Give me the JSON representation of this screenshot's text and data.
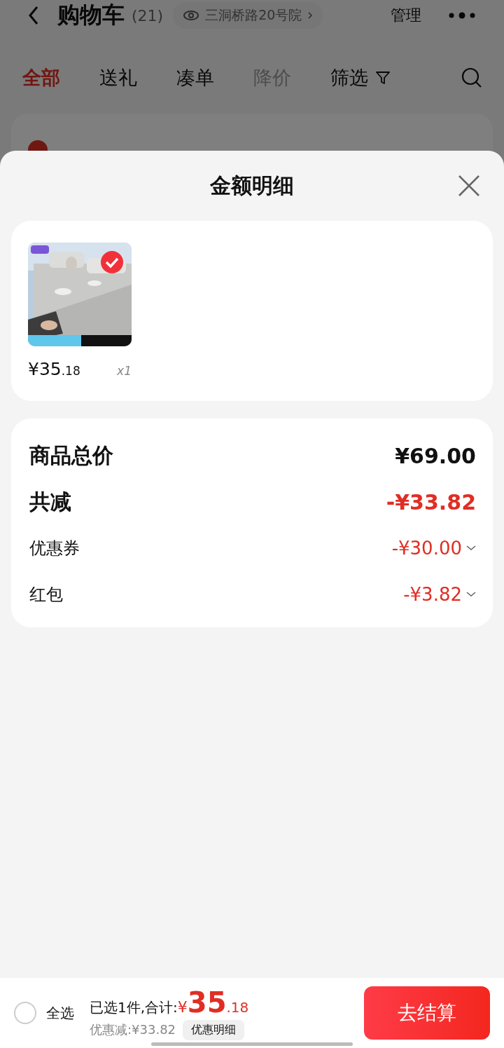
{
  "header": {
    "title": "购物车",
    "count": "(21)",
    "address": "三洞桥路20号院",
    "manage": "管理"
  },
  "tabs": [
    {
      "label": "全部",
      "selected": true,
      "disabled": false,
      "kind": "plain"
    },
    {
      "label": "送礼",
      "selected": false,
      "disabled": false,
      "kind": "plain"
    },
    {
      "label": "凑单",
      "selected": false,
      "disabled": false,
      "kind": "plain"
    },
    {
      "label": "降价",
      "selected": false,
      "disabled": true,
      "kind": "plain"
    },
    {
      "label": "筛选",
      "selected": false,
      "disabled": false,
      "kind": "filter"
    }
  ],
  "sheet": {
    "title": "金额明细",
    "items": [
      {
        "kind": "picture",
        "checked": true,
        "price_main": "¥35",
        "price_decimal": ".18",
        "quantity": "x1"
      }
    ],
    "summary": [
      {
        "kind": "total",
        "label": "商品总价",
        "value": "¥69.00"
      },
      {
        "kind": "discount",
        "label": "共减",
        "value": "-¥33.82"
      },
      {
        "kind": "detail",
        "label": "优惠券",
        "value": "-¥30.00"
      },
      {
        "kind": "detail",
        "label": "红包",
        "value": "-¥3.82"
      }
    ]
  },
  "footer": {
    "select_all": {
      "label": "全选",
      "checked": false
    },
    "prefix": "已选1件,合计:",
    "currency": "¥",
    "total_main": "35",
    "total_decimal": ".18",
    "discount": "优惠减:¥33.82",
    "detail_button": "优惠明细",
    "checkout": "去结算"
  }
}
